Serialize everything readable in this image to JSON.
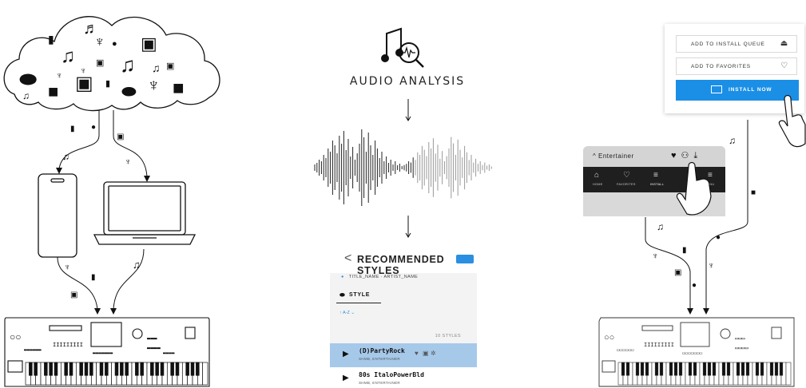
{
  "center": {
    "title": "AUDIO ANALYSIS",
    "recommended": {
      "title": "RECOMMENDED STYLES",
      "title_artist": "TITLE_NAME · ARTIST_NAME",
      "tab": "STYLE",
      "sort": "A-Z",
      "count": "10 STYLES",
      "rows": [
        {
          "name": "(D)PartyRock",
          "meta": "SHMB, ENTERTAINER"
        },
        {
          "name": "80s ItaloPowerBld",
          "meta": "SHMB, ENTERTAINER"
        }
      ]
    }
  },
  "right": {
    "queue_label": "ADD TO INSTALL QUEUE",
    "favorites_label": "ADD TO FAVORITES",
    "install_label": "INSTALL NOW",
    "song_name": "Entertainer",
    "nav": [
      "HOME",
      "FAVORITES",
      "INSTALL",
      "",
      "MENU"
    ]
  }
}
